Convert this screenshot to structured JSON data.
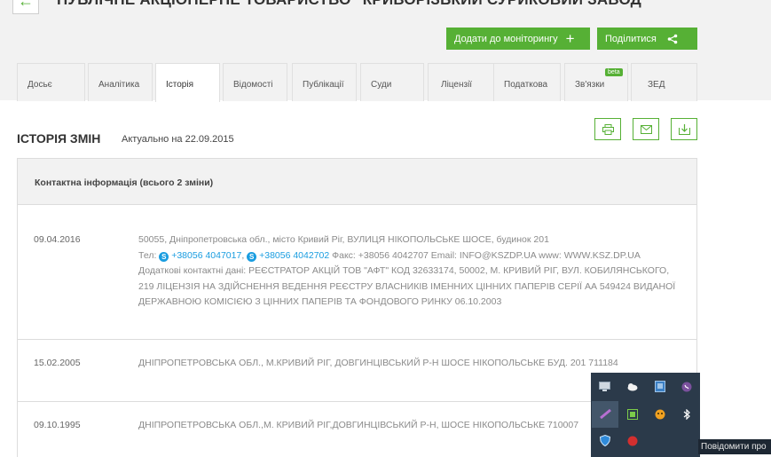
{
  "header": {
    "company_name": "ПУБЛІЧНЕ АКЦІОНЕРНЕ ТОВАРИСТВО \"КРИВОРІЗЬКИЙ СУРИКОВИЙ ЗАВОД\"",
    "back_icon": "arrow-left-icon",
    "add_monitoring_label": "Додати до моніторингу",
    "add_monitoring_plus": "+",
    "share_label": "Поділитися",
    "share_icon": "share-icon"
  },
  "tabs": [
    {
      "label": "Досьє",
      "active": false
    },
    {
      "label": "Аналітика",
      "active": false
    },
    {
      "label": "Історія",
      "active": true
    },
    {
      "label": "Відомості",
      "active": false
    },
    {
      "label": "Публікації",
      "active": false
    },
    {
      "label": "Суди",
      "active": false
    },
    {
      "label": "Ліцензії",
      "active": false
    },
    {
      "label": "Податкова",
      "active": false
    },
    {
      "label": "Зв'язки",
      "active": false,
      "badge": "beta"
    },
    {
      "label": "ЗЕД",
      "active": false
    }
  ],
  "section": {
    "title": "ІСТОРІЯ ЗМІН",
    "updated": "Актуально на 22.09.2015",
    "icons": [
      "print-icon",
      "mail-icon",
      "download-icon"
    ]
  },
  "table": {
    "header": "Контактна інформація (всього 2 зміни)",
    "rows": [
      {
        "date": "09.04.2016",
        "line1": "50055, Дніпропетровська обл., місто Кривий Ріг, ВУЛИЦЯ НІКОПОЛЬСЬКЕ ШОСЕ, будинок 201",
        "tel_label": "Тел:",
        "phone1": "+38056 4047017",
        "phone2": "+38056 4042702",
        "rest": "Факс: +38056 4042707 Email: INFO@KSZDP.UA www: WWW.KSZ.DP.UA Додаткові контактні дані: РЕЄСТРАТОР АКЦІЙ ТОВ \"АФТ\" КОД 32633174, 50002, М. КРИВИЙ РІГ, ВУЛ. КОБИЛЯНСЬКОГО, 219 ЛІЦЕНЗІЯ НА ЗДІЙСНЕННЯ ВЕДЕННЯ РЕЄСТРУ ВЛАСНИКІВ ІМЕННИХ ЦІННИХ ПАПЕРІВ СЕРІЇ АА 549424 ВИДАНОЇ ДЕРЖАВНОЮ КОМІСІЄЮ З ЦІННИХ ПАПЕРІВ ТА ФОНДОВОГО РИНКУ 06.10.2003"
      },
      {
        "date": "15.02.2005",
        "text": "ДНІПРОПЕТРОВСЬКА ОБЛ., М.КРИВИЙ РІГ, ДОВГИНЦІВСЬКИЙ Р-Н ШОСЕ НІКОПОЛЬСЬКЕ БУД. 201 711184"
      },
      {
        "date": "09.10.1995",
        "text": "ДНІПРОПЕТРОВСЬКА ОБЛ.,М. КРИВИЙ РІГ,ДОВГИНЦІВСЬКИЙ Р-Н, ШОСЕ НІКОПОЛЬСЬКЕ 710007"
      }
    ]
  },
  "system_tray": {
    "icons": [
      "monitor-icon",
      "cloud-icon",
      "network-icon",
      "viber-icon",
      "pen-icon",
      "keyboard-icon",
      "smiley-icon",
      "bluetooth-icon",
      "shield-icon",
      "record-icon"
    ],
    "tooltip": "Повідомити про"
  },
  "colors": {
    "accent": "#56b035",
    "link": "#1a9de0",
    "tray_bg": "#2b3a4a"
  }
}
